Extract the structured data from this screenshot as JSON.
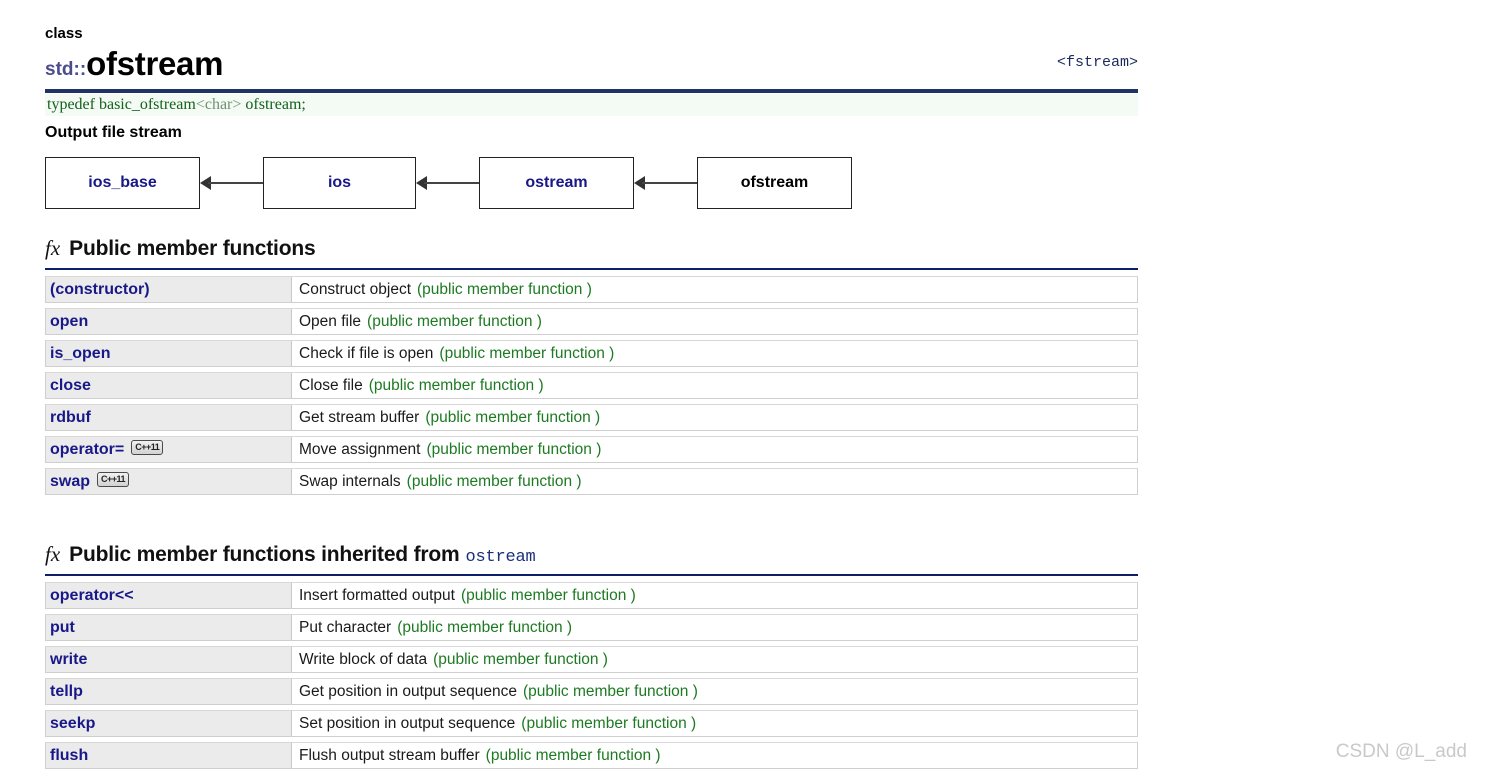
{
  "header": {
    "kind": "class",
    "namespace": "std::",
    "name": "ofstream",
    "header_file": "<fstream>",
    "prototype_prefix": "typedef basic_ofstream",
    "prototype_template": "<char>",
    "prototype_suffix": " ofstream;",
    "subtitle": "Output file stream"
  },
  "diagram": {
    "nodes": [
      {
        "label": "ios_base",
        "current": false
      },
      {
        "label": "ios",
        "current": false
      },
      {
        "label": "ostream",
        "current": false
      },
      {
        "label": "ofstream",
        "current": true
      }
    ]
  },
  "sections": [
    {
      "icon": "fx",
      "title": "Public member functions",
      "inherited_from": "",
      "rows": [
        {
          "name": "(constructor)",
          "badge": "",
          "desc": "Construct object",
          "kind": "(public member function )"
        },
        {
          "name": "open",
          "badge": "",
          "desc": "Open file",
          "kind": "(public member function )"
        },
        {
          "name": "is_open",
          "badge": "",
          "desc": "Check if file is open",
          "kind": "(public member function )"
        },
        {
          "name": "close",
          "badge": "",
          "desc": "Close file",
          "kind": "(public member function )"
        },
        {
          "name": "rdbuf",
          "badge": "",
          "desc": "Get stream buffer",
          "kind": "(public member function )"
        },
        {
          "name": "operator=",
          "badge": "C++11",
          "desc": "Move assignment",
          "kind": "(public member function )"
        },
        {
          "name": "swap",
          "badge": "C++11",
          "desc": "Swap internals",
          "kind": "(public member function )"
        }
      ]
    },
    {
      "icon": "fx",
      "title": "Public member functions inherited from",
      "inherited_from": "ostream",
      "rows": [
        {
          "name": "operator<<",
          "badge": "",
          "desc": "Insert formatted output",
          "kind": "(public member function )"
        },
        {
          "name": "put",
          "badge": "",
          "desc": "Put character",
          "kind": "(public member function )"
        },
        {
          "name": "write",
          "badge": "",
          "desc": "Write block of data",
          "kind": "(public member function )"
        },
        {
          "name": "tellp",
          "badge": "",
          "desc": "Get position in output sequence",
          "kind": "(public member function )"
        },
        {
          "name": "seekp",
          "badge": "",
          "desc": "Set position in output sequence",
          "kind": "(public member function )"
        },
        {
          "name": "flush",
          "badge": "",
          "desc": "Flush output stream buffer",
          "kind": "(public member function )"
        }
      ]
    }
  ],
  "watermark": "CSDN @L_add",
  "colors": {
    "link": "#181888",
    "rule": "#1f3364",
    "kind_text": "#1d7a22",
    "prototype_bg": "#f4fbf4",
    "cell_bg": "#ebebeb"
  }
}
